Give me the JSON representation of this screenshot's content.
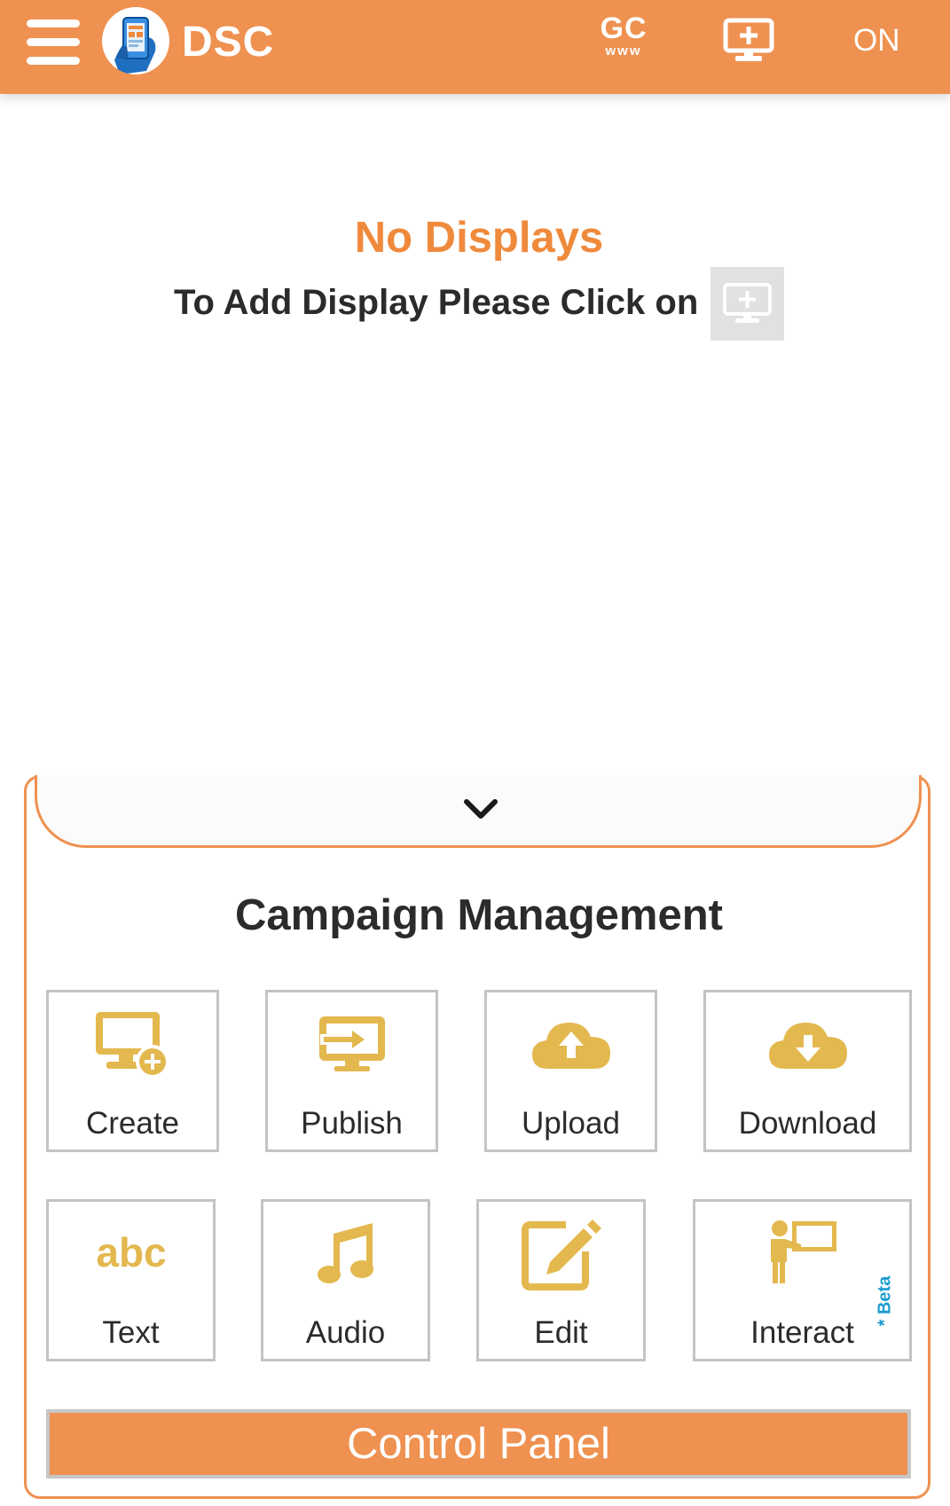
{
  "app": {
    "title": "DSC"
  },
  "topbar": {
    "gc_main": "GC",
    "gc_sub": "www",
    "status": "ON"
  },
  "empty_state": {
    "title": "No Displays",
    "subtitle": "To Add Display Please Click on"
  },
  "campaign": {
    "title": "Campaign Management",
    "tiles": [
      {
        "label": "Create",
        "icon": "monitor-add-icon"
      },
      {
        "label": "Publish",
        "icon": "monitor-publish-icon"
      },
      {
        "label": "Upload",
        "icon": "cloud-upload-icon"
      },
      {
        "label": "Download",
        "icon": "cloud-download-icon"
      },
      {
        "label": "Text",
        "icon": "abc-text-icon"
      },
      {
        "label": "Audio",
        "icon": "music-note-icon"
      },
      {
        "label": "Edit",
        "icon": "edit-pencil-icon"
      },
      {
        "label": "Interact",
        "icon": "presenter-icon",
        "badge": "* Beta"
      }
    ]
  },
  "control_panel": {
    "label": "Control Panel"
  },
  "colors": {
    "brand_orange": "#ef9150",
    "title_orange": "#ef8a3c",
    "icon_gold": "#e3b84e",
    "beta_blue": "#1a9ccf",
    "tile_border": "#c4c4c4"
  }
}
